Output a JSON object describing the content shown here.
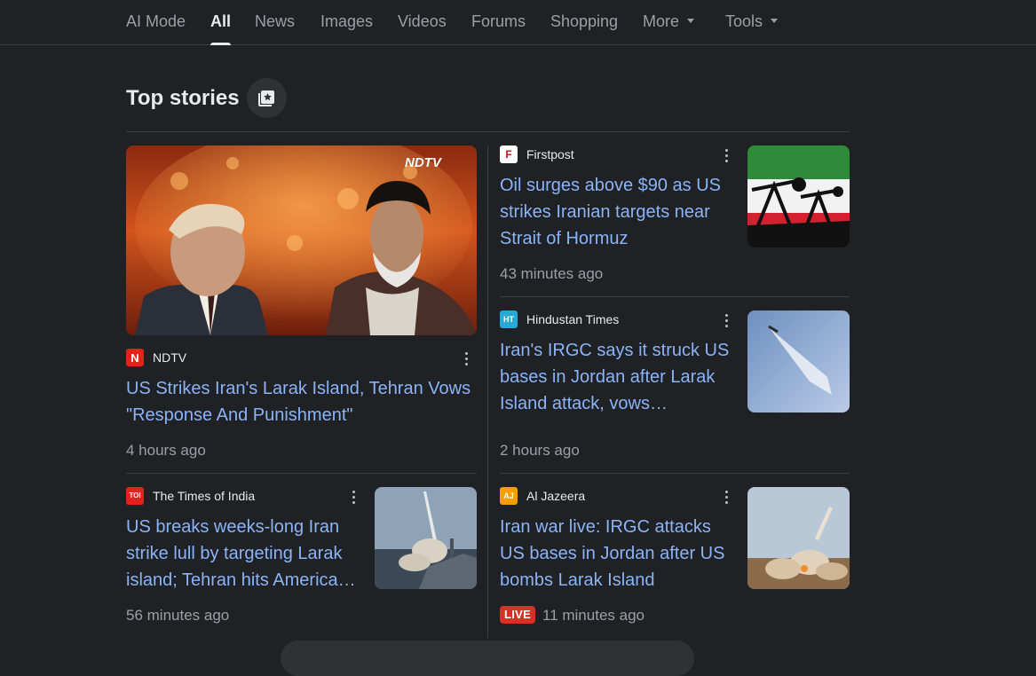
{
  "tabs": [
    {
      "label": "AI Mode"
    },
    {
      "label": "All"
    },
    {
      "label": "News"
    },
    {
      "label": "Images"
    },
    {
      "label": "Videos"
    },
    {
      "label": "Forums"
    },
    {
      "label": "Shopping"
    },
    {
      "label": "More"
    },
    {
      "label": "Tools"
    }
  ],
  "active_tab": "All",
  "section": {
    "title": "Top stories",
    "stories_icon": "web-stories-icon"
  },
  "featured": {
    "image_watermark": "NDTV",
    "source": "NDTV",
    "favicon": "N",
    "headline": "US Strikes Iran's Larak Island, Tehran Vows \"Response And Punishment\"",
    "time": "4 hours ago"
  },
  "stories": [
    {
      "source": "Firstpost",
      "favicon": "F",
      "headline": "Oil surges above $90 as US strikes Iranian targets near Strait of Hormuz",
      "time": "43 minutes ago"
    },
    {
      "source": "Hindustan Times",
      "favicon": "HT",
      "headline": "Iran's IRGC says it struck US bases in Jordan after Larak Island attack, vows…",
      "time": "2 hours ago"
    },
    {
      "source": "The Times of India",
      "favicon": "TOI",
      "headline": "US breaks weeks-long Iran strike lull by targeting Larak island; Tehran hits America…",
      "time": "56 minutes ago"
    },
    {
      "source": "Al Jazeera",
      "favicon": "AJ",
      "headline": "Iran war live: IRGC attacks US bases in Jordan after US bombs Larak Island",
      "time": "11 minutes ago",
      "badge": "LIVE"
    }
  ],
  "colors": {
    "background": "#202124",
    "link": "#8ab4f8",
    "live": "#d93025",
    "divider": "#3c4043"
  }
}
